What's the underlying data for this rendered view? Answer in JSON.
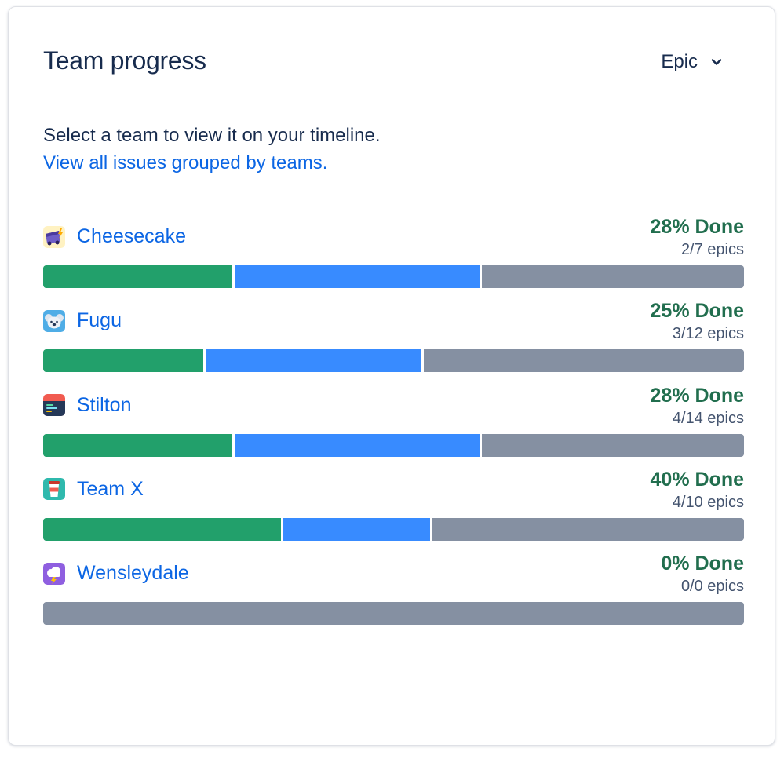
{
  "panel": {
    "title": "Team progress",
    "grouping": {
      "selected": "Epic",
      "icon": "chevron-down-icon"
    },
    "intro": "Select a team to view it on your timeline.",
    "view_all_link": "View all issues grouped by teams."
  },
  "colors": {
    "done": "#22a06b",
    "in_progress": "#388bff",
    "to_do": "#8590a2",
    "link": "#0c66e4",
    "done_text": "#216e4e"
  },
  "teams": [
    {
      "name": "Cheesecake",
      "icon": "cheesecake-team-icon",
      "done_label": "28% Done",
      "epics_label": "2/7 epics",
      "progress": {
        "done": 0.272,
        "in_progress": 0.352,
        "to_do": 0.376
      }
    },
    {
      "name": "Fugu",
      "icon": "koala-team-icon",
      "done_label": "25% Done",
      "epics_label": "3/12 epics",
      "progress": {
        "done": 0.23,
        "in_progress": 0.31,
        "to_do": 0.46
      }
    },
    {
      "name": "Stilton",
      "icon": "code-window-team-icon",
      "done_label": "28% Done",
      "epics_label": "4/14 epics",
      "progress": {
        "done": 0.272,
        "in_progress": 0.352,
        "to_do": 0.376
      }
    },
    {
      "name": "Team X",
      "icon": "coffee-cup-team-icon",
      "done_label": "40% Done",
      "epics_label": "4/10 epics",
      "progress": {
        "done": 0.342,
        "in_progress": 0.21,
        "to_do": 0.448
      }
    },
    {
      "name": "Wensleydale",
      "icon": "storm-cloud-team-icon",
      "done_label": "0% Done",
      "epics_label": "0/0 epics",
      "progress": {
        "done": 0,
        "in_progress": 0,
        "to_do": 1
      }
    }
  ]
}
